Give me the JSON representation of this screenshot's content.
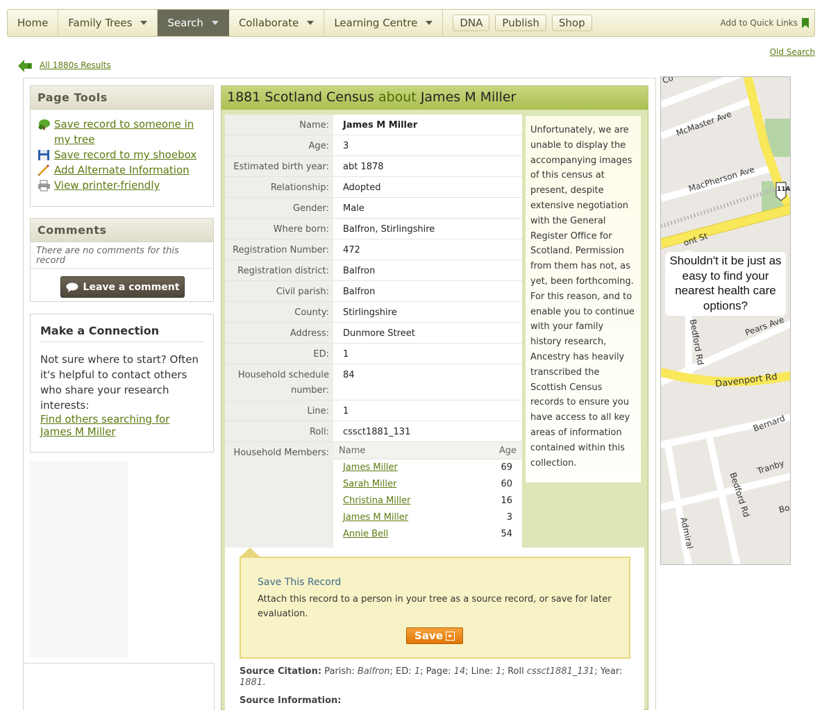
{
  "nav": {
    "items": [
      {
        "label": "Home",
        "dropdown": false
      },
      {
        "label": "Family Trees",
        "dropdown": true
      },
      {
        "label": "Search",
        "dropdown": true,
        "active": true
      },
      {
        "label": "Collaborate",
        "dropdown": true
      },
      {
        "label": "Learning Centre",
        "dropdown": true
      }
    ],
    "buttons": [
      "DNA",
      "Publish",
      "Shop"
    ],
    "quick_links": "Add to Quick Links"
  },
  "old_search": "Old Search",
  "back_link": "All 1880s Results",
  "page_tools": {
    "title": "Page Tools",
    "items": [
      {
        "label": "Save record to someone in my tree",
        "icon": "tree-save-icon"
      },
      {
        "label": "Save record to my shoebox",
        "icon": "floppy-disk-icon"
      },
      {
        "label": "Add Alternate Information",
        "icon": "pencil-icon"
      },
      {
        "label": "View printer-friendly",
        "icon": "printer-icon"
      }
    ]
  },
  "comments": {
    "title": "Comments",
    "empty": "There are no comments for this record",
    "button": "Leave a comment"
  },
  "connection": {
    "title": "Make a Connection",
    "text": "Not sure where to start? Often it's helpful to contact others who share your research interests:",
    "link": "Find others searching for James M Miller"
  },
  "record": {
    "collection": "1881 Scotland Census",
    "about": "about",
    "person": "James M Miller",
    "facts": [
      {
        "label": "Name:",
        "value": "James M Miller"
      },
      {
        "label": "Age:",
        "value": "3"
      },
      {
        "label": "Estimated birth year:",
        "value": "abt 1878"
      },
      {
        "label": "Relationship:",
        "value": "Adopted"
      },
      {
        "label": "Gender:",
        "value": "Male"
      },
      {
        "label": "Where born:",
        "value": "Balfron, Stirlingshire"
      },
      {
        "label": "Registration Number:",
        "value": "472"
      },
      {
        "label": "Registration district:",
        "value": "Balfron"
      },
      {
        "label": "Civil parish:",
        "value": "Balfron"
      },
      {
        "label": "County:",
        "value": "Stirlingshire"
      },
      {
        "label": "Address:",
        "value": "Dunmore Street"
      },
      {
        "label": "ED:",
        "value": "1"
      },
      {
        "label": "Household schedule number:",
        "value": "84"
      },
      {
        "label": "Line:",
        "value": "1"
      },
      {
        "label": "Roll:",
        "value": "cssct1881_131"
      }
    ],
    "household_label": "Household Members:",
    "household_cols": {
      "name": "Name",
      "age": "Age"
    },
    "household": [
      {
        "name": "James Miller",
        "age": "69"
      },
      {
        "name": "Sarah Miller",
        "age": "60"
      },
      {
        "name": "Christina Miller",
        "age": "16"
      },
      {
        "name": "James M Miller",
        "age": "3"
      },
      {
        "name": "Annie Bell",
        "age": "54"
      }
    ],
    "notice": "Unfortunately, we are unable to display the accompanying images of this census at present, despite extensive negotiation with the General Register Office for Scotland. Permission from them has not, as yet, been forthcoming. For this reason, and to enable you to continue with your family history research, Ancestry has heavily transcribed the Scottish Census records to ensure you have access to all key areas of information contained within this collection."
  },
  "save": {
    "title": "Save This Record",
    "desc": "Attach this record to a person in your tree as a source record, or save for later evaluation.",
    "button": "Save"
  },
  "citation": {
    "label": "Source Citation:",
    "parish_k": "Parish:",
    "parish_v": "Balfron",
    "ed_k": "; ED:",
    "ed_v": "1",
    "page_k": "; Page:",
    "page_v": "14",
    "line_k": "; Line:",
    "line_v": "1",
    "roll_k": "; Roll",
    "roll_v": "cssct1881_131",
    "year_k": "; Year:",
    "year_v": "1881",
    "source_info": "Source Information:"
  },
  "map_ad": {
    "caption": "Shouldn't it be just as easy to find your nearest health care options?",
    "streets": [
      "McMaster Ave",
      "MacPherson Ave",
      "ont St",
      "Pears Ave",
      "Bedford Rd",
      "Davenport Rd",
      "Bernard",
      "Tranby",
      "Bedford Rd",
      "Admiral",
      "Co",
      "Bo"
    ],
    "highway": "11A"
  }
}
